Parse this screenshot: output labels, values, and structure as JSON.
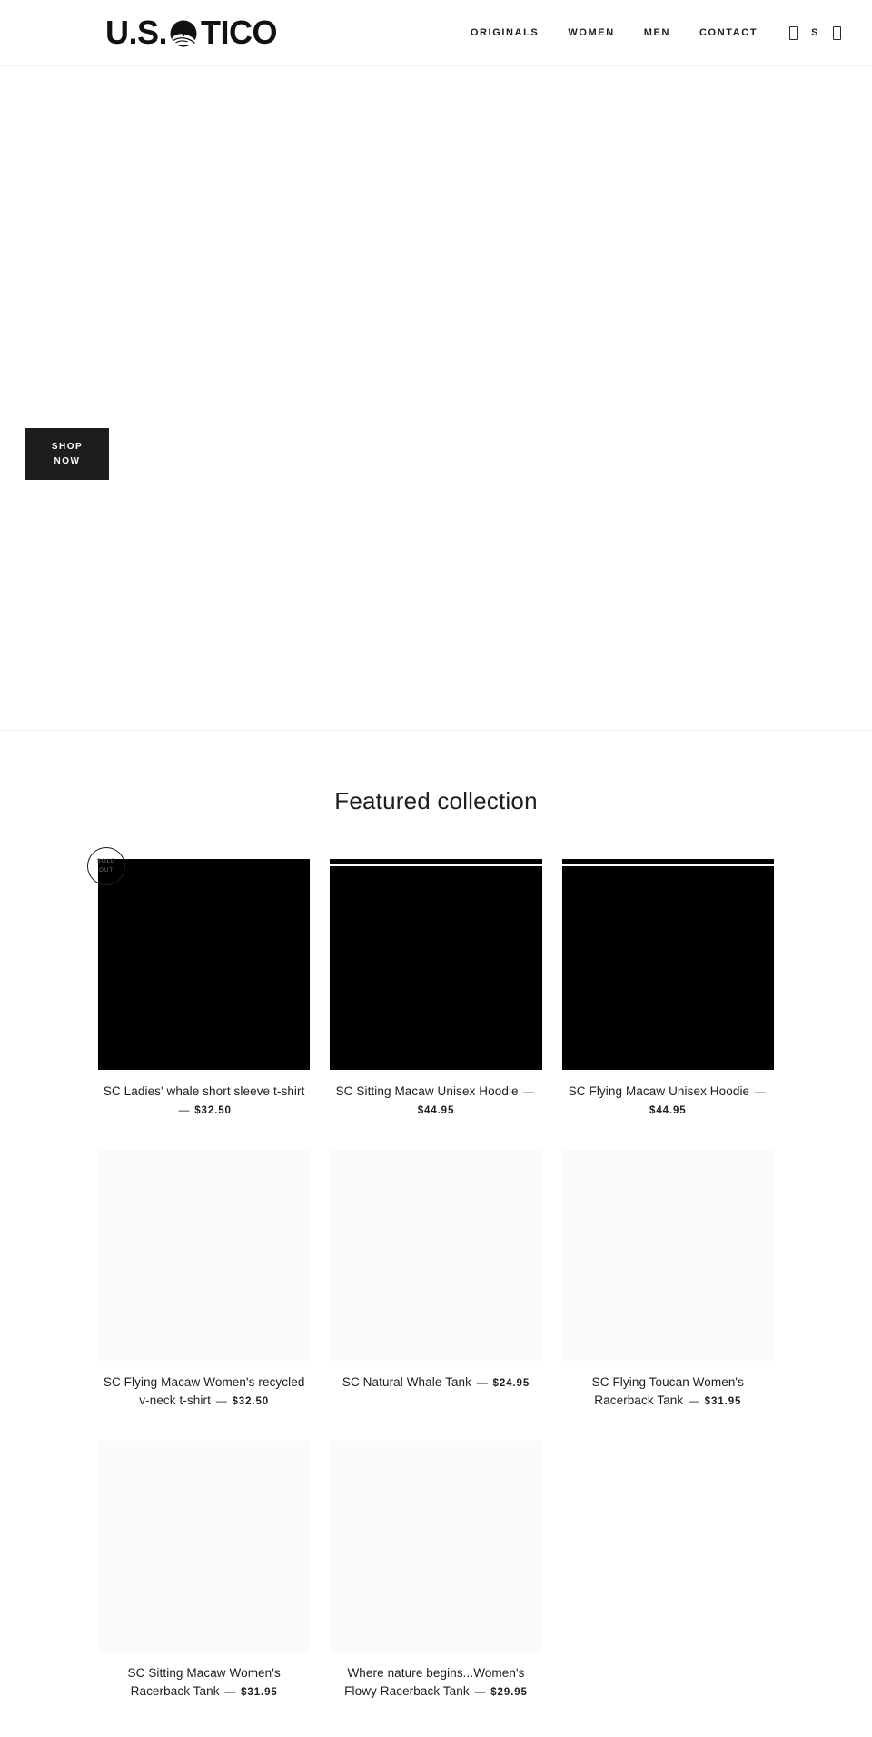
{
  "header": {
    "logo": {
      "text_left": "U.S.",
      "text_right": "TICO",
      "mark_name": "palm-tree-wave-logo-mark"
    },
    "nav": [
      {
        "label": "ORIGINALS",
        "name": "nav-originals"
      },
      {
        "label": "WOMEN",
        "name": "nav-women"
      },
      {
        "label": "MEN",
        "name": "nav-men"
      },
      {
        "label": "CONTACT",
        "name": "nav-contact"
      }
    ],
    "icons": {
      "search_glyph": "",
      "cart_glyph": "",
      "currency_code": "S"
    }
  },
  "hero": {
    "shop_now_line1": "SHOP",
    "shop_now_line2": "NOW"
  },
  "collection": {
    "title": "Featured collection",
    "price_separator": "—",
    "sold_out_line1": "SOLD",
    "sold_out_line2": "OUT",
    "products": [
      {
        "title": "SC Ladies' whale short sleeve t-shirt",
        "price": "$32.50",
        "media": "dark",
        "sold_out": true,
        "stripe": false
      },
      {
        "title": "SC Sitting Macaw Unisex Hoodie",
        "price": "$44.95",
        "media": "dark",
        "sold_out": false,
        "stripe": true
      },
      {
        "title": "SC Flying Macaw Unisex Hoodie",
        "price": "$44.95",
        "media": "dark",
        "sold_out": false,
        "stripe": true
      },
      {
        "title": "SC Flying Macaw Women's recycled v-neck t-shirt",
        "price": "$32.50",
        "media": "light",
        "sold_out": false,
        "stripe": false
      },
      {
        "title": "SC Natural Whale Tank",
        "price": "$24.95",
        "media": "light",
        "sold_out": false,
        "stripe": false
      },
      {
        "title": "SC Flying Toucan Women's Racerback Tank",
        "price": "$31.95",
        "media": "light",
        "sold_out": false,
        "stripe": false
      },
      {
        "title": "SC Sitting Macaw Women's Racerback Tank",
        "price": "$31.95",
        "media": "light",
        "sold_out": false,
        "stripe": false
      },
      {
        "title": "Where nature begins...Women's Flowy Racerback Tank",
        "price": "$29.95",
        "media": "light",
        "sold_out": false,
        "stripe": false
      }
    ]
  },
  "colors": {
    "text": "#1c1d1d",
    "button_bg": "#1c1d1d",
    "button_text": "#ffffff",
    "page_bg": "#ffffff",
    "media_light": "#fafafa",
    "media_dark": "#000000",
    "border": "#eeeeee"
  }
}
